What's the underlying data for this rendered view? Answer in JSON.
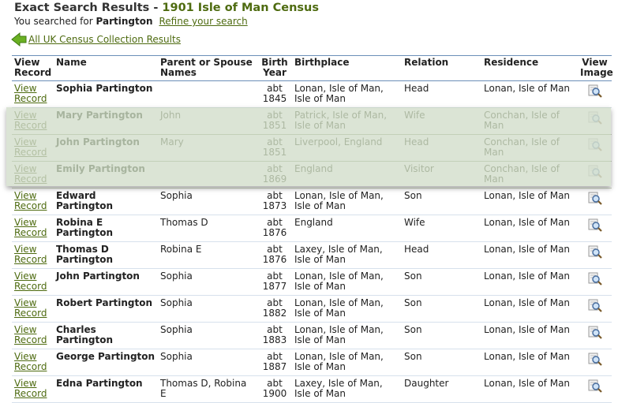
{
  "header": {
    "title_prefix": "Exact Search Results - ",
    "title_db": "1901 Isle of Man Census",
    "searched_prefix": "You searched for ",
    "searched_term": "Partington",
    "refine_link": "Refine your search",
    "all_results_link": "All UK Census Collection Results"
  },
  "table": {
    "columns": [
      "View Record",
      "Name",
      "Parent or Spouse Names",
      "Birth Year",
      "Birthplace",
      "Relation",
      "Residence",
      "View Image"
    ],
    "view_record_label": "View Record",
    "rows": [
      {
        "name": "Sophia Partington",
        "parent": "",
        "birth": "abt 1845",
        "birthplace": "Lonan, Isle of Man, Isle of Man",
        "relation": "Head",
        "residence": "Lonan, Isle of Man",
        "dim": false
      },
      {
        "name": "Mary Partington",
        "parent": "John",
        "birth": "abt 1851",
        "birthplace": "Patrick, Isle of Man, Isle of Man",
        "relation": "Wife",
        "residence": "Conchan, Isle of Man",
        "dim": true
      },
      {
        "name": "John Partington",
        "parent": "Mary",
        "birth": "abt 1851",
        "birthplace": "Liverpool, England",
        "relation": "Head",
        "residence": "Conchan, Isle of Man",
        "dim": true
      },
      {
        "name": "Emily Partington",
        "parent": "",
        "birth": "abt 1869",
        "birthplace": "England",
        "relation": "Visitor",
        "residence": "Conchan, Isle of Man",
        "dim": true
      },
      {
        "name": "Edward Partington",
        "parent": "Sophia",
        "birth": "abt 1873",
        "birthplace": "Lonan, Isle of Man, Isle of Man",
        "relation": "Son",
        "residence": "Lonan, Isle of Man",
        "dim": false
      },
      {
        "name": "Robina E Partington",
        "parent": "Thomas D",
        "birth": "abt 1876",
        "birthplace": "England",
        "relation": "Wife",
        "residence": "Lonan, Isle of Man",
        "dim": false
      },
      {
        "name": "Thomas D Partington",
        "parent": "Robina E",
        "birth": "abt 1876",
        "birthplace": "Laxey, Isle of Man, Isle of Man",
        "relation": "Head",
        "residence": "Lonan, Isle of Man",
        "dim": false
      },
      {
        "name": "John Partington",
        "parent": "Sophia",
        "birth": "abt 1877",
        "birthplace": "Lonan, Isle of Man, Isle of Man",
        "relation": "Son",
        "residence": "Lonan, Isle of Man",
        "dim": false
      },
      {
        "name": "Robert Partington",
        "parent": "Sophia",
        "birth": "abt 1882",
        "birthplace": "Lonan, Isle of Man, Isle of Man",
        "relation": "Son",
        "residence": "Lonan, Isle of Man",
        "dim": false
      },
      {
        "name": "Charles Partington",
        "parent": "Sophia",
        "birth": "abt 1883",
        "birthplace": "Lonan, Isle of Man, Isle of Man",
        "relation": "Son",
        "residence": "Lonan, Isle of Man",
        "dim": false
      },
      {
        "name": "George Partington",
        "parent": "Sophia",
        "birth": "abt 1887",
        "birthplace": "Lonan, Isle of Man, Isle of Man",
        "relation": "Son",
        "residence": "Lonan, Isle of Man",
        "dim": false
      },
      {
        "name": "Edna Partington",
        "parent": "Thomas D, Robina E",
        "birth": "abt 1900",
        "birthplace": "Laxey, Isle of Man, Isle of Man",
        "relation": "Daughter",
        "residence": "Lonan, Isle of Man",
        "dim": false
      }
    ]
  },
  "icons": {
    "back": "green-left-arrow-icon",
    "image": "magnifier-icon"
  },
  "colors": {
    "accent": "#4e6b10",
    "highlight": "#becbb2",
    "border": "#6b8fb8"
  }
}
